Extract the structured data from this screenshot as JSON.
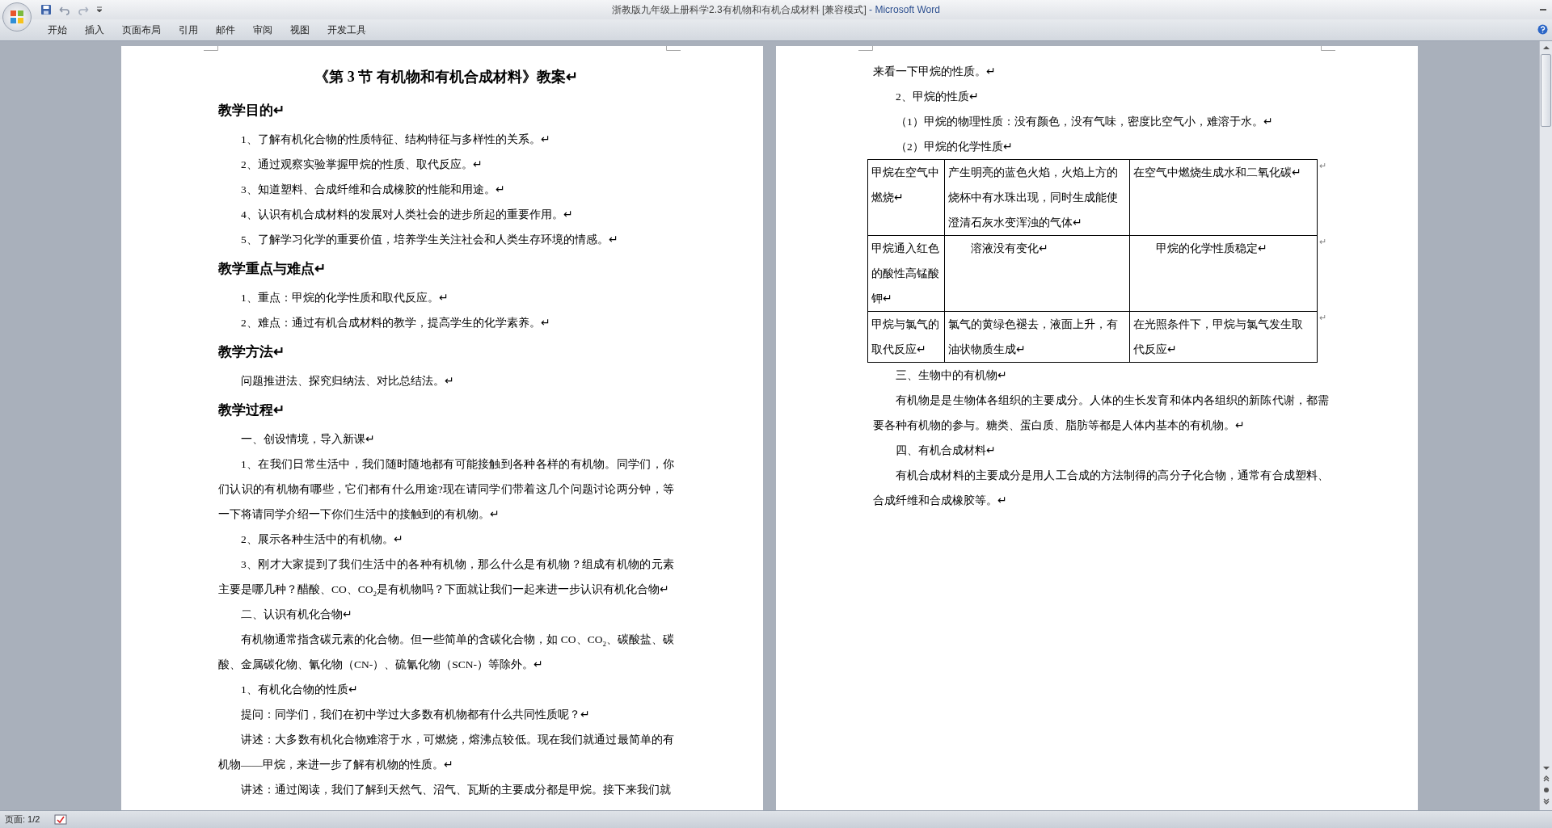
{
  "window": {
    "title": "浙教版九年级上册科学2.3有机物和有机合成材料 [兼容模式]",
    "app_name": "- Microsoft Word"
  },
  "ribbon_tabs": [
    "开始",
    "插入",
    "页面布局",
    "引用",
    "邮件",
    "审阅",
    "视图",
    "开发工具"
  ],
  "pages": [
    {
      "blocks": [
        {
          "kind": "title",
          "text": "《第 3 节  有机物和有机合成材料》教案↵"
        },
        {
          "kind": "heading",
          "text": "教学目的↵"
        },
        {
          "kind": "indented",
          "text": "1、了解有机化合物的性质特征、结构特征与多样性的关系。↵"
        },
        {
          "kind": "indented",
          "text": "2、通过观察实验掌握甲烷的性质、取代反应。↵"
        },
        {
          "kind": "indented",
          "text": "3、知道塑料、合成纤维和合成橡胶的性能和用途。↵"
        },
        {
          "kind": "indented",
          "text": "4、认识有机合成材料的发展对人类社会的进步所起的重要作用。↵"
        },
        {
          "kind": "indented",
          "text": "5、了解学习化学的重要价值，培养学生关注社会和人类生存环境的情感。↵"
        },
        {
          "kind": "heading",
          "text": "教学重点与难点↵"
        },
        {
          "kind": "indented",
          "text": "1、重点：甲烷的化学性质和取代反应。↵"
        },
        {
          "kind": "indented",
          "text": "2、难点：通过有机合成材料的教学，提高学生的化学素养。↵"
        },
        {
          "kind": "heading",
          "text": "教学方法↵"
        },
        {
          "kind": "indented",
          "text": "问题推进法、探究归纳法、对比总结法。↵"
        },
        {
          "kind": "heading",
          "text": "教学过程↵"
        },
        {
          "kind": "indented",
          "text": "一、创设情境，导入新课↵"
        },
        {
          "kind": "indented",
          "text": "1、在我们日常生活中，我们随时随地都有可能接触到各种各样的有机物。同学们，你们认识的有机物有哪些，它们都有什么用途?现在请同学们带着这几个问题讨论两分钟，等一下将请同学介绍一下你们生活中的接触到的有机物。↵"
        },
        {
          "kind": "indented",
          "text": "2、展示各种生活中的有机物。↵"
        },
        {
          "kind": "indented",
          "text": "3、刚才大家提到了我们生活中的各种有机物，那么什么是有机物？组成有机物的元素主要是哪几种？醋酸、CO、CO$_{2}$是有机物吗？下面就让我们一起来进一步认识有机化合物↵"
        },
        {
          "kind": "indented",
          "text": "二、认识有机化合物↵"
        },
        {
          "kind": "indented",
          "text": "有机物通常指含碳元素的化合物。但一些简单的含碳化合物，如 CO、CO$_{2}$、碳酸盐、碳酸、金属碳化物、氰化物（CN-）、硫氰化物（SCN-）等除外。↵"
        },
        {
          "kind": "indented",
          "text": "1、有机化合物的性质↵"
        },
        {
          "kind": "indented",
          "text": "提问：同学们，我们在初中学过大多数有机物都有什么共同性质呢？↵"
        },
        {
          "kind": "indented",
          "text": "讲述：大多数有机化合物难溶于水，可燃烧，熔沸点较低。现在我们就通过最简单的有机物——甲烷，来进一步了解有机物的性质。↵"
        },
        {
          "kind": "indented",
          "text": "讲述：通过阅读，我们了解到天然气、沼气、瓦斯的主要成分都是甲烷。接下来我们就"
        }
      ]
    },
    {
      "blocks": [
        {
          "kind": "plain",
          "text": "来看一下甲烷的性质。↵"
        },
        {
          "kind": "indented",
          "text": "2、甲烷的性质↵"
        },
        {
          "kind": "indented",
          "text": "（1）甲烷的物理性质：没有颜色，没有气味，密度比空气小，难溶于水。↵"
        },
        {
          "kind": "indented",
          "text": "（2）甲烷的化学性质↵"
        },
        {
          "kind": "table",
          "rows": [
            {
              "cells": [
                {
                  "text": "甲烷在空气中燃烧↵",
                  "indent": false
                },
                {
                  "text": "产生明亮的蓝色火焰，火焰上方的烧杯中有水珠出现，同时生成能使澄清石灰水变浑浊的气体↵",
                  "indent": false
                },
                {
                  "text": "在空气中燃烧生成水和二氧化碳↵",
                  "indent": false
                }
              ],
              "end_mark": "↵"
            },
            {
              "cells": [
                {
                  "text": "甲烷通入红色的酸性高锰酸钾↵",
                  "indent": false
                },
                {
                  "text": "溶液没有变化↵",
                  "indent": true
                },
                {
                  "text": "甲烷的化学性质稳定↵",
                  "indent": true
                }
              ],
              "end_mark": "↵"
            },
            {
              "cells": [
                {
                  "text": "甲烷与氯气的取代反应↵",
                  "indent": false
                },
                {
                  "text": "氯气的黄绿色褪去，液面上升，有油状物质生成↵",
                  "indent": false
                },
                {
                  "text": "在光照条件下，甲烷与氯气发生取代反应↵",
                  "indent": false
                }
              ],
              "end_mark": "↵"
            }
          ]
        },
        {
          "kind": "indented",
          "text": "三、生物中的有机物↵"
        },
        {
          "kind": "indented",
          "text": "有机物是是生物体各组织的主要成分。人体的生长发育和体内各组织的新陈代谢，都需要各种有机物的参与。糖类、蛋白质、脂肪等都是人体内基本的有机物。↵"
        },
        {
          "kind": "indented",
          "text": "四、有机合成材料↵"
        },
        {
          "kind": "indented",
          "text": "有机合成材料的主要成分是用人工合成的方法制得的高分子化合物，通常有合成塑料、合成纤维和合成橡胶等。↵"
        }
      ]
    }
  ],
  "status_bar": {
    "page": "页面: 1/2"
  }
}
